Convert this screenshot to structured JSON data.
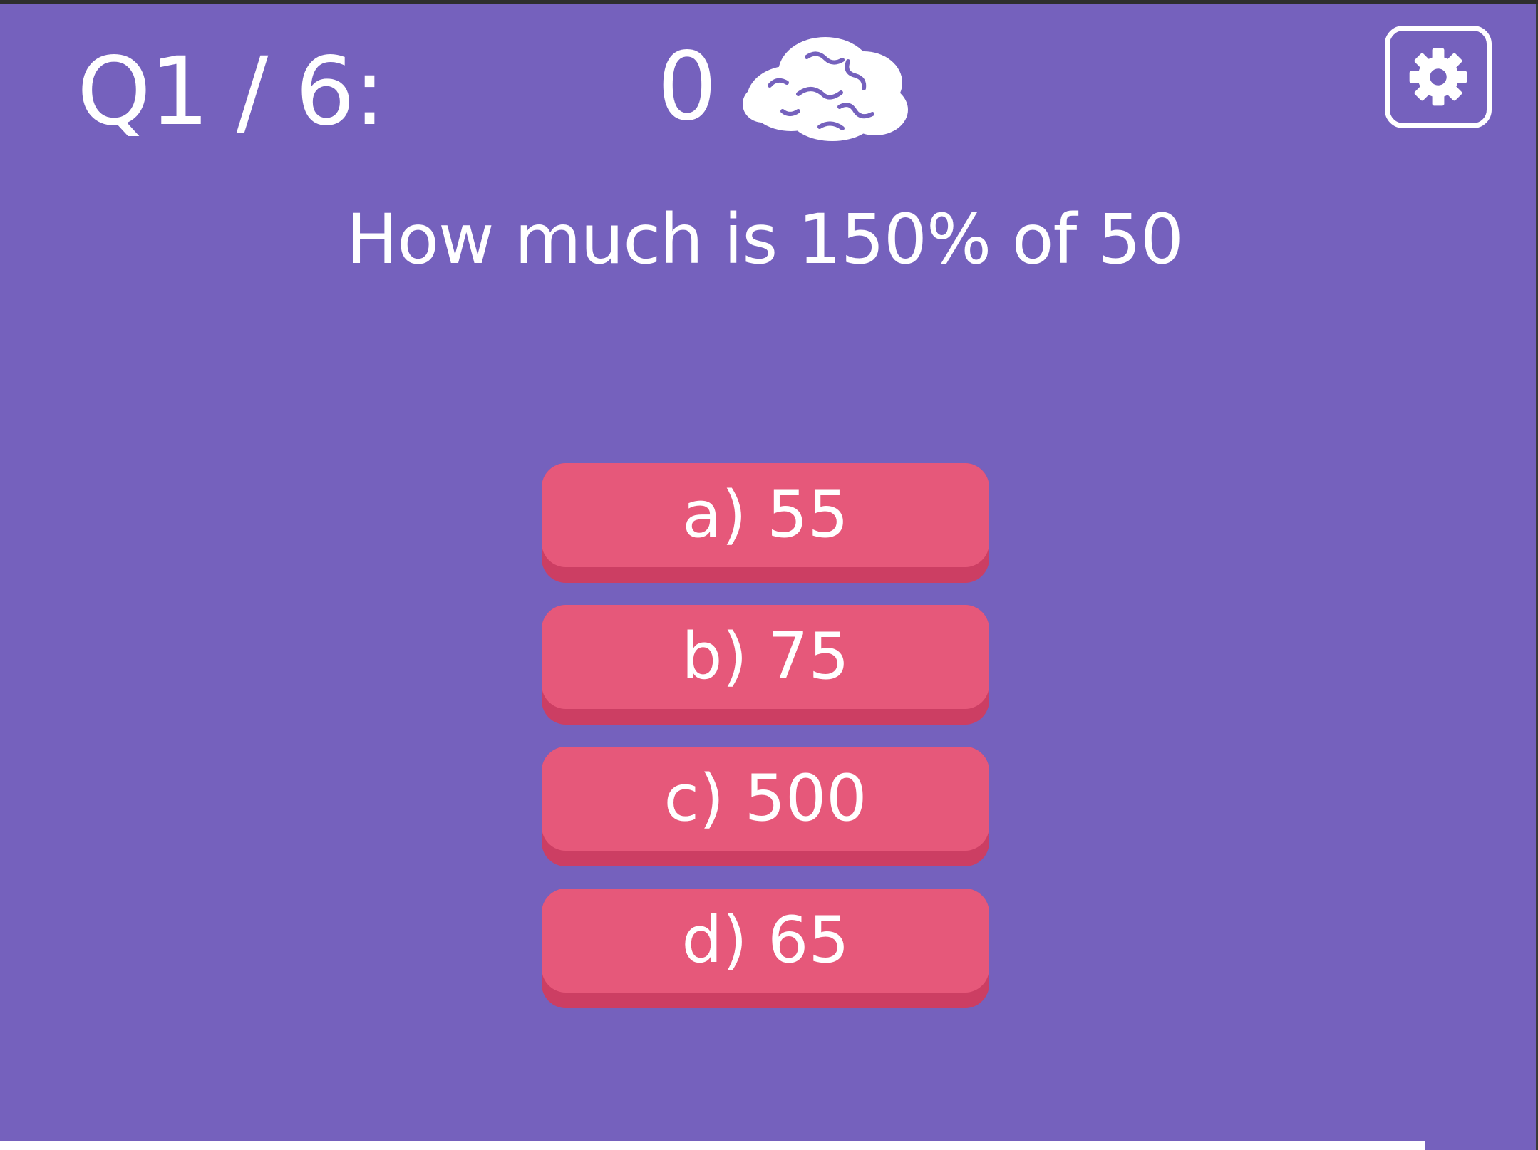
{
  "header": {
    "question_counter": "Q1 / 6:",
    "score": "0",
    "score_icon": "brain-icon",
    "settings_icon": "gear-icon"
  },
  "question": {
    "text": "How much is 150% of 50"
  },
  "answers": [
    {
      "label": "a) 55"
    },
    {
      "label": "b) 75"
    },
    {
      "label": "c) 500"
    },
    {
      "label": "d) 65"
    }
  ],
  "colors": {
    "background": "#7561bd",
    "answer_button": "#e6587a",
    "answer_button_shadow": "#cc3e63",
    "text": "#ffffff"
  }
}
